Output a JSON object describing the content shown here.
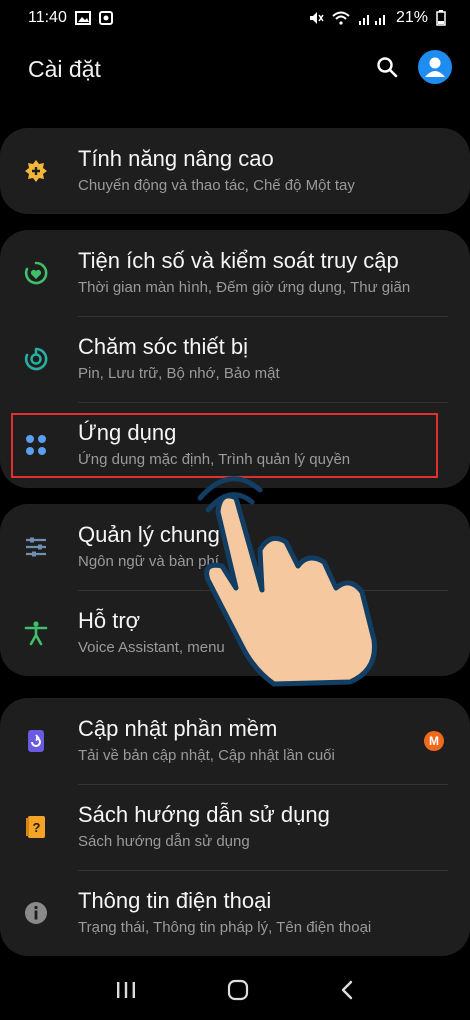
{
  "status_bar": {
    "time": "11:40",
    "battery": "21%",
    "icons": [
      "gallery-icon",
      "screenshot-icon",
      "mute-icon",
      "wifi-icon",
      "signal-icon",
      "battery-icon"
    ]
  },
  "header": {
    "title": "Cài đặt",
    "actions": [
      "search-icon",
      "account-icon"
    ]
  },
  "colors": {
    "card_bg": "#1e1e1e",
    "highlight_border": "#e03030",
    "badge": "#f06a1d"
  },
  "groups": [
    {
      "items": [
        {
          "icon": "advanced-features-icon",
          "title": "Tính năng nâng cao",
          "subtitle": "Chuyển động và thao tác, Chế độ Một tay"
        }
      ]
    },
    {
      "items": [
        {
          "icon": "digital-wellbeing-icon",
          "title": "Tiện ích số và kiểm soát truy cập",
          "subtitle": "Thời gian màn hình, Đếm giờ ứng dụng, Thư giãn"
        },
        {
          "icon": "device-care-icon",
          "title": "Chăm sóc thiết bị",
          "subtitle": "Pin, Lưu trữ, Bộ nhớ, Bảo mật"
        },
        {
          "icon": "apps-icon",
          "title": "Ứng dụng",
          "subtitle": "Ứng dụng mặc định, Trình quản lý quyền"
        }
      ]
    },
    {
      "items": [
        {
          "icon": "general-management-icon",
          "title": "Quản lý chung",
          "subtitle": "Ngôn ngữ và bàn phí"
        },
        {
          "icon": "accessibility-icon",
          "title": "Hỗ trợ",
          "subtitle": "Voice Assistant, menu"
        }
      ]
    },
    {
      "items": [
        {
          "icon": "software-update-icon",
          "title": "Cập nhật phần mềm",
          "subtitle": "Tải về bản cập nhật, Cập nhật lần cuối",
          "badge": "M"
        },
        {
          "icon": "user-manual-icon",
          "title": "Sách hướng dẫn sử dụng",
          "subtitle": "Sách hướng dẫn sử dụng"
        },
        {
          "icon": "about-phone-icon",
          "title": "Thông tin điện thoại",
          "subtitle": "Trạng thái, Thông tin pháp lý, Tên điện thoại"
        }
      ]
    }
  ],
  "nav_bar": [
    "recents-icon",
    "home-icon",
    "back-icon"
  ]
}
